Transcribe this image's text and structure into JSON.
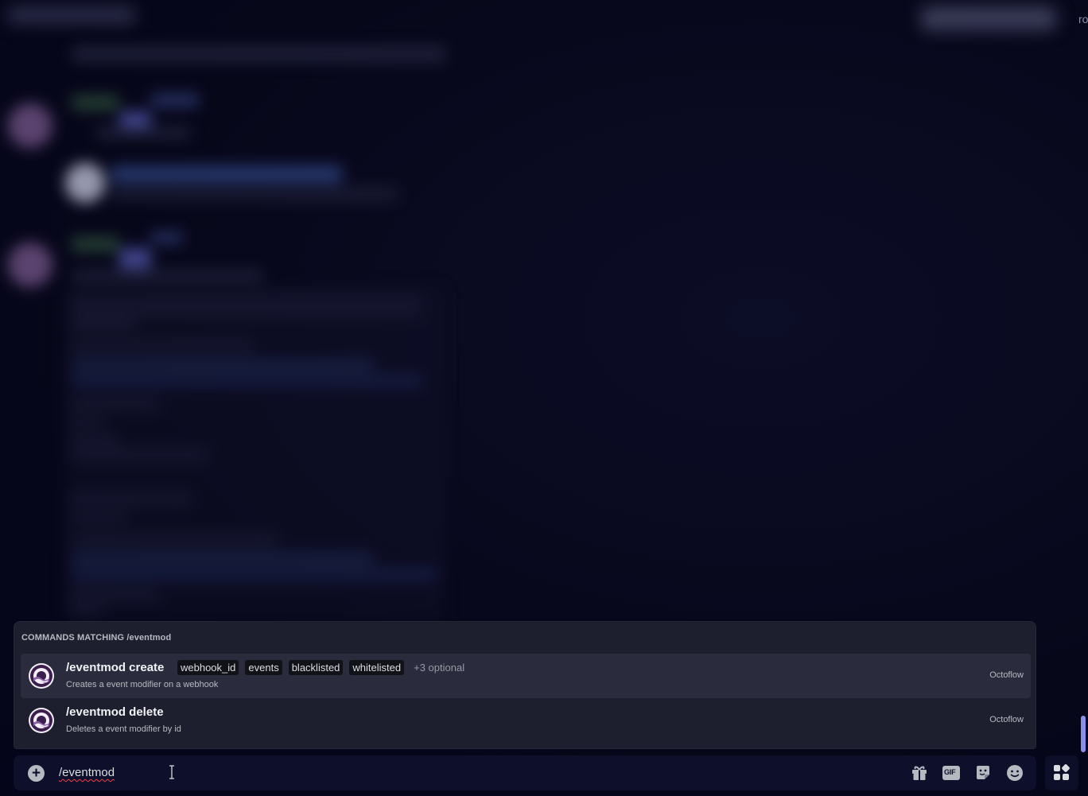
{
  "edge_text": "ro",
  "popup": {
    "header_label": "Commands Matching",
    "header_query": "/eventmod",
    "commands": [
      {
        "name": "/eventmod create",
        "params": [
          "webhook_id",
          "events",
          "blacklisted",
          "whitelisted"
        ],
        "optional": "+3 optional",
        "description": "Creates a event modifier on a webhook",
        "source": "Octoflow",
        "selected": true
      },
      {
        "name": "/eventmod delete",
        "params": [],
        "optional": "",
        "description": "Deletes a event modifier by id",
        "source": "Octoflow",
        "selected": false
      }
    ]
  },
  "input": {
    "value": "/eventmod",
    "icons": [
      "plus-icon",
      "gift-icon",
      "gif-icon",
      "sticker-icon",
      "emoji-icon",
      "apps-icon"
    ],
    "gif_label": "GIF"
  },
  "colors": {
    "accent": "#8c8fe8",
    "background": "#07071a",
    "popup_bg": "#1e1f2e",
    "input_bg": "#0e0f2b",
    "error_underline": "#f23f43"
  }
}
